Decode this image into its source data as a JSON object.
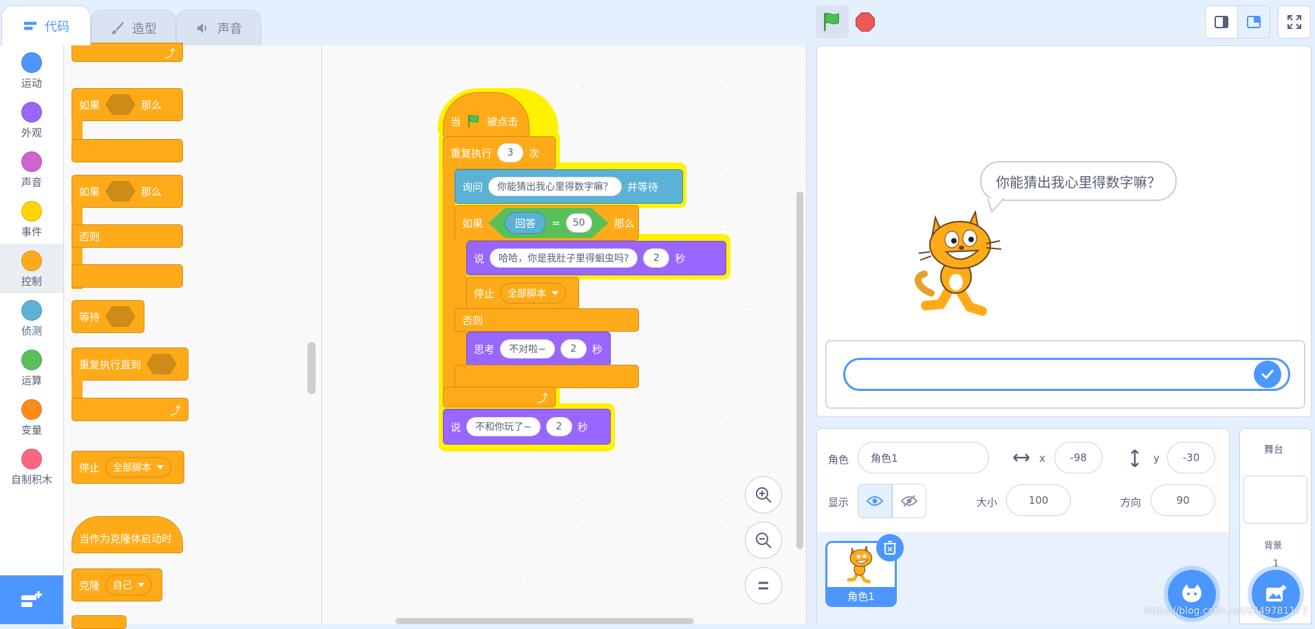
{
  "tabs": [
    {
      "label": "代码",
      "icon": "code-icon",
      "active": true
    },
    {
      "label": "造型",
      "icon": "costume-brush-icon",
      "active": false
    },
    {
      "label": "声音",
      "icon": "speaker-icon",
      "active": false
    }
  ],
  "categories": [
    {
      "label": "运动",
      "color": "#4c97ff"
    },
    {
      "label": "外观",
      "color": "#9966ff"
    },
    {
      "label": "声音",
      "color": "#cf63cf"
    },
    {
      "label": "事件",
      "color": "#ffd500"
    },
    {
      "label": "控制",
      "color": "#ffab19",
      "selected": true
    },
    {
      "label": "侦测",
      "color": "#5cb1d6"
    },
    {
      "label": "运算",
      "color": "#59c059"
    },
    {
      "label": "变量",
      "color": "#ff8c1a"
    },
    {
      "label": "自制积木",
      "color": "#ff6680"
    }
  ],
  "palette": {
    "if_then": {
      "if": "如果",
      "then": "那么"
    },
    "if_else": {
      "if": "如果",
      "then": "那么",
      "else": "否则"
    },
    "wait_until": "等待",
    "repeat_until": "重复执行直到",
    "stop": {
      "label": "停止",
      "option": "全部脚本"
    },
    "clone_start": "当作为克隆体启动时",
    "clone": {
      "label": "克隆",
      "option": "自己"
    }
  },
  "script": {
    "hat": {
      "when": "当",
      "clicked": "被点击"
    },
    "repeat": {
      "label": "重复执行",
      "count": "3",
      "times": "次"
    },
    "ask": {
      "label": "询问",
      "text": "你能猜出我心里得数字嘛？",
      "wait": "并等待"
    },
    "if": {
      "label": "如果",
      "answer": "回答",
      "eq": "=",
      "value": "50",
      "then": "那么"
    },
    "say1": {
      "label": "说",
      "text": "哈哈，你是我肚子里得蛔虫吗?",
      "secs": "2",
      "unit": "秒"
    },
    "stop": {
      "label": "停止",
      "option": "全部脚本"
    },
    "else": "否则",
    "think": {
      "label": "思考",
      "text": "不对啦~",
      "secs": "2",
      "unit": "秒"
    },
    "say2": {
      "label": "说",
      "text": "不和你玩了~",
      "secs": "2",
      "unit": "秒"
    }
  },
  "stage": {
    "bubble": "你能猜出我心里得数字嘛？"
  },
  "sprite_info": {
    "sprite_label": "角色",
    "sprite_name": "角色1",
    "x_label": "x",
    "x": "-98",
    "y_label": "y",
    "y": "-30",
    "show_label": "显示",
    "size_label": "大小",
    "size": "100",
    "direction_label": "方向",
    "direction": "90"
  },
  "sprite_list": [
    {
      "name": "角色1"
    }
  ],
  "stage_panel": {
    "title": "舞台",
    "backdrops_label": "背景",
    "backdrops_count": "1"
  },
  "watermark": "https://blog.csdn.net/s349781173"
}
